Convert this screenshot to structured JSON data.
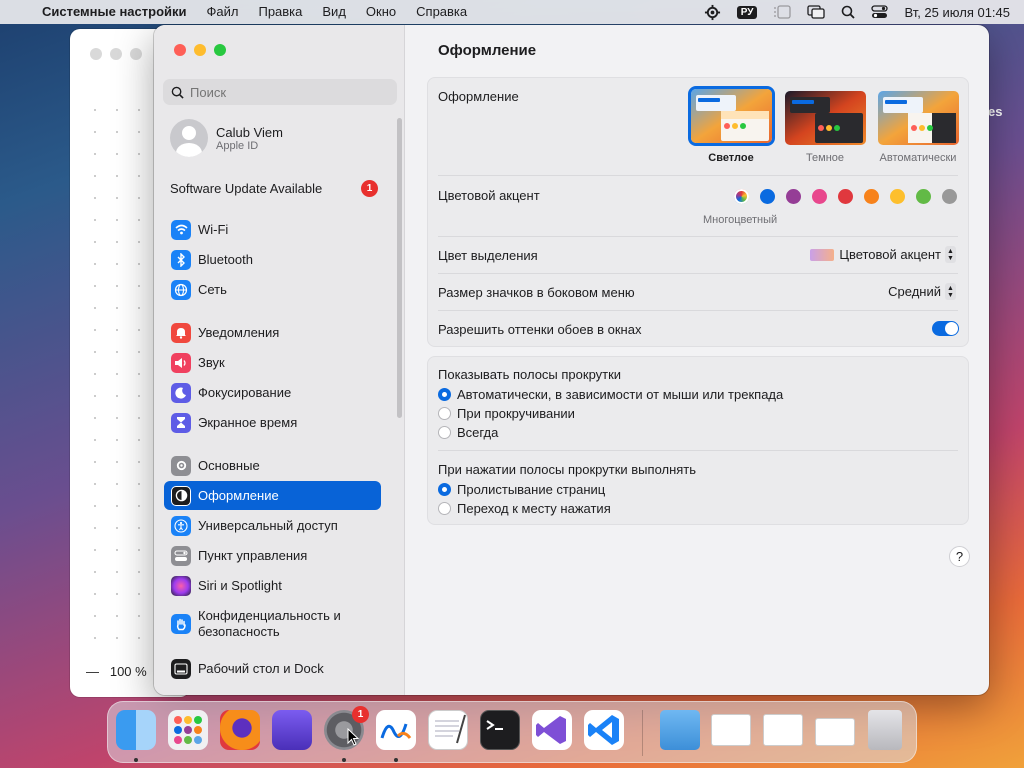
{
  "menubar": {
    "app_name": "Системные настройки",
    "items": [
      "Файл",
      "Правка",
      "Вид",
      "Окно",
      "Справка"
    ],
    "input_lang": "РУ",
    "clock": "Вт, 25 июля  01:45"
  },
  "back_window": {
    "zoom": "100 %"
  },
  "sidebar": {
    "search_placeholder": "Поиск",
    "account_name": "Calub Viem",
    "account_sub": "Apple ID",
    "update_label": "Software Update Available",
    "update_count": "1",
    "items": [
      {
        "label": "Wi-Fi",
        "icon": "wifi-icon",
        "color": "#1a82f7"
      },
      {
        "label": "Bluetooth",
        "icon": "bluetooth-icon",
        "color": "#1a82f7"
      },
      {
        "label": "Сеть",
        "icon": "globe-icon",
        "color": "#1a82f7"
      },
      {
        "label": "Уведомления",
        "icon": "bell-icon",
        "color": "#f0483e"
      },
      {
        "label": "Звук",
        "icon": "speaker-icon",
        "color": "#f0405f"
      },
      {
        "label": "Фокусирование",
        "icon": "moon-icon",
        "color": "#5e5ce6"
      },
      {
        "label": "Экранное время",
        "icon": "hourglass-icon",
        "color": "#5e5ce6"
      },
      {
        "label": "Основные",
        "icon": "gear-icon",
        "color": "#8e8e93"
      },
      {
        "label": "Оформление",
        "icon": "appearance-icon",
        "color": "#1d1d1f"
      },
      {
        "label": "Универсальный доступ",
        "icon": "accessibility-icon",
        "color": "#1a82f7"
      },
      {
        "label": "Пункт управления",
        "icon": "control-center-icon",
        "color": "#8e8e93"
      },
      {
        "label": "Siri и Spotlight",
        "icon": "siri-icon",
        "color": "#c13fd4"
      },
      {
        "label": "Конфиденциальность и безопасность",
        "icon": "hand-icon",
        "color": "#1a82f7"
      },
      {
        "label": "Рабочий стол и Dock",
        "icon": "dock-icon",
        "color": "#1d1d1f"
      }
    ]
  },
  "content": {
    "title": "Оформление",
    "appearance_label": "Оформление",
    "appearance_options": [
      {
        "label": "Светлое",
        "selected": true
      },
      {
        "label": "Темное",
        "selected": false
      },
      {
        "label": "Автоматически",
        "selected": false
      }
    ],
    "accent_label": "Цветовой акцент",
    "accent_selected_name": "Многоцветный",
    "accent_colors": [
      "multicolor",
      "#0a6ae0",
      "#953d96",
      "#e8478d",
      "#e0383e",
      "#f7821b",
      "#fdbf2d",
      "#62ba46",
      "#989898"
    ],
    "highlight_label": "Цвет выделения",
    "highlight_value": "Цветовой акцент",
    "sidebar_icon_label": "Размер значков в боковом меню",
    "sidebar_icon_value": "Средний",
    "wallpaper_tint_label": "Разрешить оттенки обоев в окнах",
    "wallpaper_tint_on": true,
    "scrollbars_label": "Показывать полосы прокрутки",
    "scrollbar_options": [
      {
        "label": "Автоматически, в зависимости от мыши или трекпада",
        "selected": true
      },
      {
        "label": "При прокручивании",
        "selected": false
      },
      {
        "label": "Всегда",
        "selected": false
      }
    ],
    "click_label": "При нажатии полосы прокрутки выполнять",
    "click_options": [
      {
        "label": "Пролистывание страниц",
        "selected": true
      },
      {
        "label": "Переход к месту нажатия",
        "selected": false
      }
    ],
    "help": "?"
  },
  "dock": {
    "settings_badge": "1",
    "apps": [
      "finder-icon",
      "launchpad-icon",
      "firefox-icon",
      "setapp-icon",
      "system-settings-icon",
      "freeform-icon",
      "textedit-icon",
      "terminal-icon",
      "visual-studio-icon",
      "vscode-icon",
      "downloads-folder-icon",
      "window-thumb-icon",
      "window-thumb-icon",
      "window-thumb-icon",
      "trash-icon"
    ]
  }
}
